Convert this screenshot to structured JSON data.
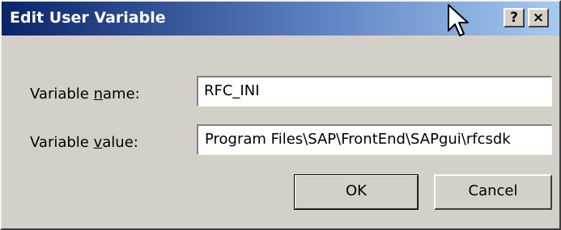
{
  "window": {
    "title": "Edit User Variable",
    "help_button": "?",
    "close_button": "×"
  },
  "form": {
    "name_label_pre": "Variable ",
    "name_label_key": "n",
    "name_label_post": "ame:",
    "name_value": "RFC_INI",
    "value_label_pre": "Variable ",
    "value_label_key": "v",
    "value_label_post": "alue:",
    "value_value": "Program Files\\SAP\\FrontEnd\\SAPgui\\rfcsdk"
  },
  "buttons": {
    "ok": "OK",
    "cancel": "Cancel"
  },
  "colors": {
    "titlebar_start": "#0a246a",
    "titlebar_end": "#a6caf0",
    "face": "#d4d0c8"
  }
}
